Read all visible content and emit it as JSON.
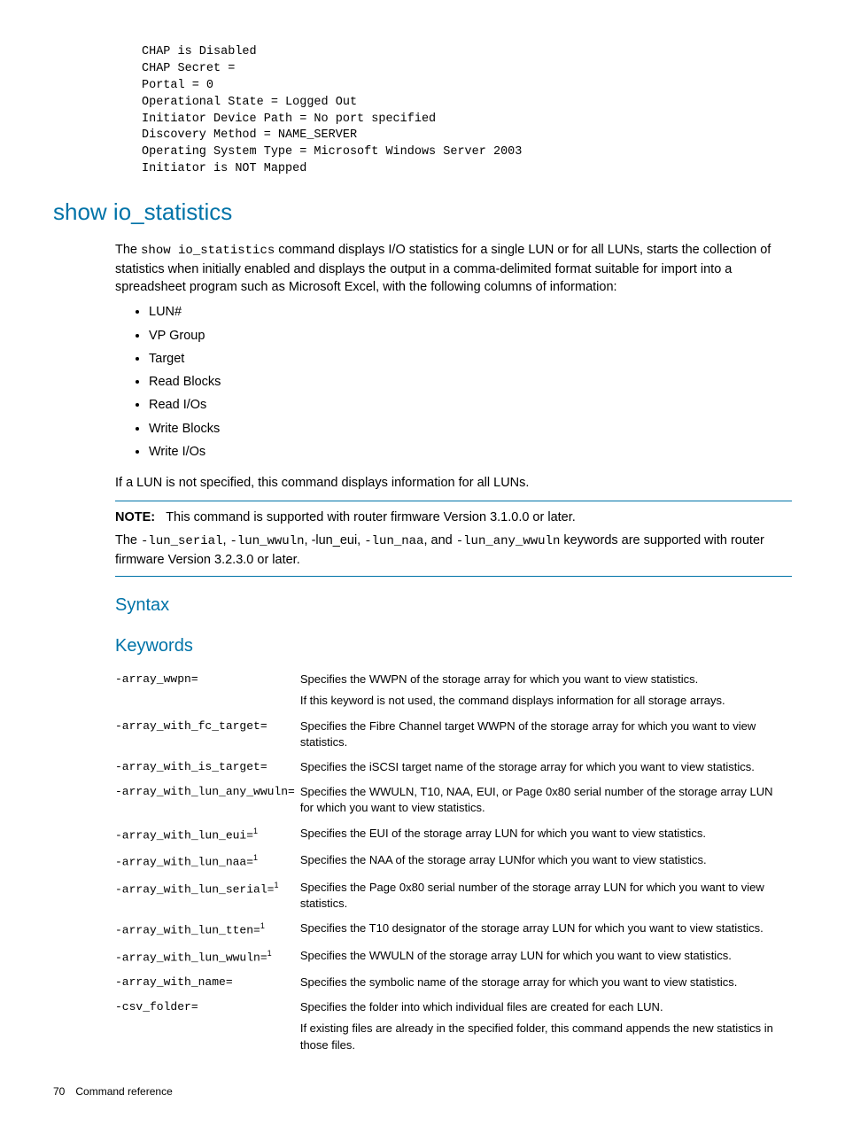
{
  "code_block": "CHAP is Disabled\nCHAP Secret =\nPortal = 0\nOperational State = Logged Out\nInitiator Device Path = No port specified\nDiscovery Method = NAME_SERVER\nOperating System Type = Microsoft Windows Server 2003\nInitiator is NOT Mapped",
  "section_title": "show io_statistics",
  "intro": {
    "prefix": "The ",
    "code": "show io_statistics",
    "suffix": " command displays I/O statistics for a single LUN or for all LUNs, starts the collection of statistics when initially enabled and displays the output in a comma-delimited format suitable for import into a spreadsheet program such as Microsoft Excel, with the following columns of information:"
  },
  "columns": [
    "LUN#",
    "VP Group",
    "Target",
    "Read Blocks",
    "Read I/Os",
    "Write Blocks",
    "Write I/Os"
  ],
  "post_list": "If a LUN is not specified, this command displays information for all LUNs.",
  "note": {
    "label": "NOTE:",
    "line1": "This command is supported with router firmware Version 3.1.0.0 or later.",
    "line2_pre": "The ",
    "kw1": "-lun_serial",
    "sep1": ", ",
    "kw2": "-lun_wwuln",
    "sep2": ", -lun_eui, ",
    "kw3": "-lun_naa",
    "sep3": ", and ",
    "kw4": "-lun_any_wwuln",
    "line2_post": " keywords are supported with router firmware Version 3.2.3.0 or later."
  },
  "syntax_heading": "Syntax",
  "keywords_heading": "Keywords",
  "keywords": [
    {
      "kw": "-array_wwpn=",
      "sup": "",
      "desc": "Specifies the WWPN of the storage array for which you want to view statistics.",
      "desc2": "If this keyword is not used, the command displays information for all storage arrays."
    },
    {
      "kw": "-array_with_fc_target=",
      "sup": "",
      "desc": "Specifies the Fibre Channel target WWPN of the storage array for which you want to view statistics.",
      "desc2": ""
    },
    {
      "kw": "-array_with_is_target=",
      "sup": "",
      "desc": "Specifies the iSCSI target name of the storage array for which you want to view statistics.",
      "desc2": ""
    },
    {
      "kw": "-array_with_lun_any_wwuln=",
      "sup": "",
      "desc": "Specifies the WWULN, T10, NAA, EUI, or Page 0x80 serial number of the storage array LUN for which you want to view statistics.",
      "desc2": ""
    },
    {
      "kw": "-array_with_lun_eui=",
      "sup": "1",
      "desc": "Specifies the EUI of the storage array LUN for which you want to view statistics.",
      "desc2": ""
    },
    {
      "kw": "-array_with_lun_naa=",
      "sup": "1",
      "desc": "Specifies the NAA of the storage array LUNfor which you want to view statistics.",
      "desc2": ""
    },
    {
      "kw": "-array_with_lun_serial=",
      "sup": "1",
      "desc": "Specifies the Page 0x80 serial number of the storage array LUN for which you want to view statistics.",
      "desc2": ""
    },
    {
      "kw": "-array_with_lun_tten=",
      "sup": "1",
      "desc": "Specifies the T10 designator of the storage array LUN for which you want to view statistics.",
      "desc2": ""
    },
    {
      "kw": "-array_with_lun_wwuln=",
      "sup": "1",
      "desc": "Specifies the WWULN of the storage array LUN for which you want to view statistics.",
      "desc2": ""
    },
    {
      "kw": "-array_with_name=",
      "sup": "",
      "desc": "Specifies the symbolic name of the storage array for which you want to view statistics.",
      "desc2": ""
    },
    {
      "kw": "-csv_folder=",
      "sup": "",
      "desc": "Specifies the folder into which individual files are created for each LUN.",
      "desc2": "If existing files are already in the specified folder, this command appends the new statistics in those files."
    }
  ],
  "footer": {
    "page": "70",
    "label": "Command reference"
  }
}
